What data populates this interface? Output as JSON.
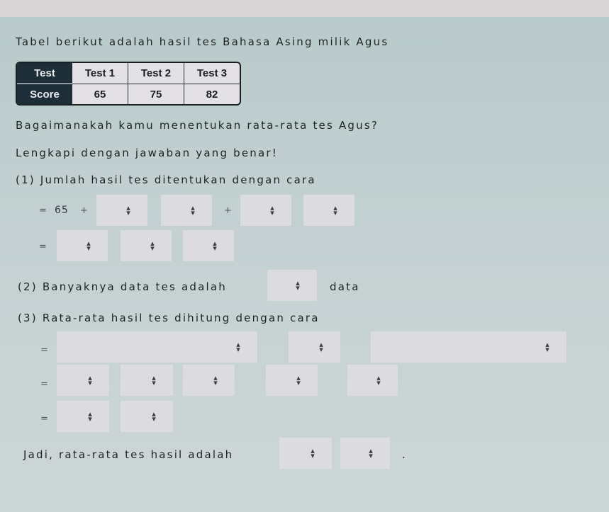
{
  "intro": "Tabel berikut adalah hasil tes Bahasa Asing milik Agus",
  "table": {
    "row_headers": [
      "Test",
      "Score"
    ],
    "columns": [
      "Test 1",
      "Test 2",
      "Test 3"
    ],
    "scores": [
      "65",
      "75",
      "82"
    ]
  },
  "question": "Bagaimanakah kamu menentukan rata-rata tes Agus?",
  "instruction": "Lengkapi dengan jawaban yang benar!",
  "step1": {
    "label": "(1)  Jumlah hasil tes ditentukan dengan cara",
    "line1": {
      "eq": "=",
      "first_value": "65",
      "plus1": "+",
      "plus2": "+"
    },
    "line2": {
      "eq": "="
    }
  },
  "step2": {
    "label": "(2) Banyaknya data tes adalah",
    "suffix": "data"
  },
  "step3": {
    "label": "(3) Rata-rata hasil tes dihitung dengan cara",
    "eq1": "=",
    "eq2": "=",
    "eq3": "="
  },
  "conclusion": {
    "label": "Jadi, rata-rata tes hasil adalah",
    "suffix": "."
  },
  "dropdown_icon": "up-down-chevron-icon",
  "colors": {
    "background": "#c3d0d1",
    "table_header": "#1e2e38",
    "dropdown_bg": "#dcdcde"
  }
}
